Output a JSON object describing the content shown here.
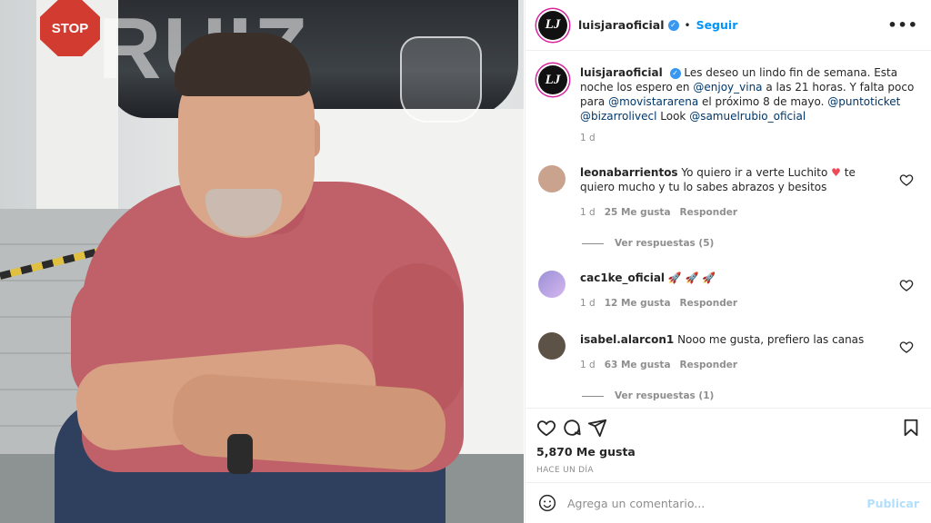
{
  "photo": {
    "stop_sign": "STOP",
    "sign_text": "RUIZ"
  },
  "header": {
    "username": "luisjaraoficial",
    "verified_icon": "verified-badge-icon",
    "separator": "•",
    "follow_label": "Seguir",
    "more_label": "•••"
  },
  "caption": {
    "username": "luisjaraoficial",
    "text_1": "Les deseo un lindo fin de semana. Esta noche los espero en",
    "mention_1": "@enjoy_vina",
    "text_2": "a las 21 horas. Y falta poco para",
    "mention_2": "@movistararena",
    "text_3": "el próximo 8 de mayo.",
    "mention_3": "@puntoticket",
    "mention_4": "@bizarrolivecl",
    "text_4": "Look",
    "mention_5": "@samuelrubio_oficial",
    "time": "1 d"
  },
  "comments": [
    {
      "username": "leonabarrientos",
      "text_before": "Yo quiero ir a verte Luchito",
      "emoji": "♥",
      "text_after": "te quiero mucho y tu lo sabes abrazos y besitos",
      "time": "1 d",
      "likes": "25 Me gusta",
      "reply": "Responder",
      "view_replies": "Ver respuestas (5)",
      "avatar_color": "#c9a38d"
    },
    {
      "username": "cac1ke_oficial",
      "text_before": "🚀 🚀 🚀",
      "time": "1 d",
      "likes": "12 Me gusta",
      "reply": "Responder",
      "avatar_color": "#9a8fd6"
    },
    {
      "username": "isabel.alarcon1",
      "text_before": "Nooo me gusta, prefiero las canas",
      "time": "1 d",
      "likes": "63 Me gusta",
      "reply": "Responder",
      "view_replies": "Ver respuestas (1)",
      "avatar_color": "#5c5346"
    }
  ],
  "actions": {
    "likes": "5,870 Me gusta",
    "when": "HACE UN DÍA"
  },
  "add_comment": {
    "placeholder": "Agrega un comentario...",
    "post_label": "Publicar"
  },
  "colors": {
    "accent": "#0095f6",
    "verified": "#3897f0",
    "link": "#00376b",
    "muted": "#8e8e8e",
    "heart_red": "#ed4956"
  }
}
